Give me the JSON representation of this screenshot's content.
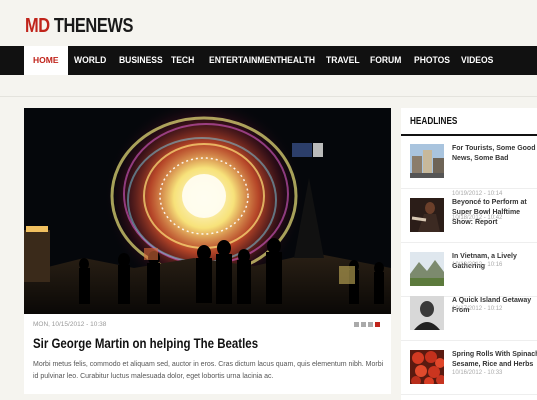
{
  "site": {
    "logo_prefix": "MD",
    "logo_name": "THENEWS"
  },
  "nav": {
    "items": [
      {
        "label": "HOME",
        "active": true
      },
      {
        "label": "WORLD"
      },
      {
        "label": "BUSINESS"
      },
      {
        "label": "TECH"
      },
      {
        "label": "ENTERTAINMENT"
      },
      {
        "label": "HEALTH"
      },
      {
        "label": "TRAVEL"
      },
      {
        "label": "FORUM"
      },
      {
        "label": "PHOTOS"
      },
      {
        "label": "VIDEOS"
      }
    ]
  },
  "featured": {
    "date": "MON, 10/15/2012 - 10:38",
    "title": "Sir George Martin on helping The Beatles",
    "excerpt": "Morbi metus felis, commodo et aliquam sed, auctor in eros. Cras dictum lacus quam, quis elementum nibh. Morbi id pulvinar leo. Curabitur luctus malesuada dolor, eget lobortis urna lacinia ac.",
    "slides": 4,
    "active_slide": 4
  },
  "sidebar": {
    "heading": "HEADLINES",
    "items": [
      {
        "title": "For Tourists, Some Good News, Some Bad",
        "date": "10/19/2012 - 10:14",
        "thumb": "buildings-photo"
      },
      {
        "title": "Beyoncé to Perform at Super Bowl Halftime Show: Report",
        "date": "10/18/2012 - 10:42",
        "thumb": "performer-photo"
      },
      {
        "title": "In Vietnam, a Lively Gathering",
        "date": "10/18/2012 - 10:16",
        "thumb": "mountain-photo"
      },
      {
        "title": "A Quick Island Getaway From",
        "date": "10/17/2012 - 10:12",
        "thumb": "portrait-photo"
      },
      {
        "title": "Spring Rolls With Spinach, Sesame, Rice and Herbs",
        "date": "10/16/2012 - 10:33",
        "thumb": "tomatoes-photo"
      }
    ]
  }
}
